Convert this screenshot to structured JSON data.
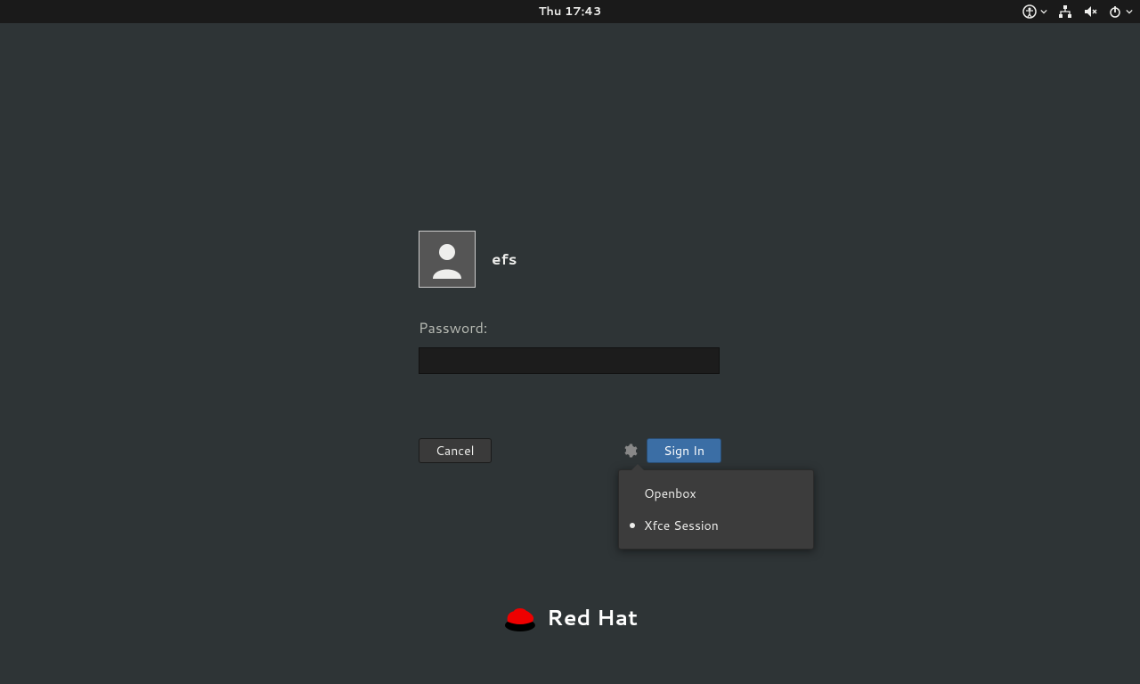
{
  "topbar": {
    "clock": "Thu 17:43"
  },
  "login": {
    "username": "efs",
    "password_label": "Password:",
    "password_value": ""
  },
  "buttons": {
    "cancel": "Cancel",
    "signin": "Sign In"
  },
  "session_menu": {
    "items": [
      {
        "label": "Openbox",
        "selected": false
      },
      {
        "label": "Xfce Session",
        "selected": true
      }
    ]
  },
  "branding": {
    "text": "Red Hat",
    "hat_color": "#ee0000"
  }
}
